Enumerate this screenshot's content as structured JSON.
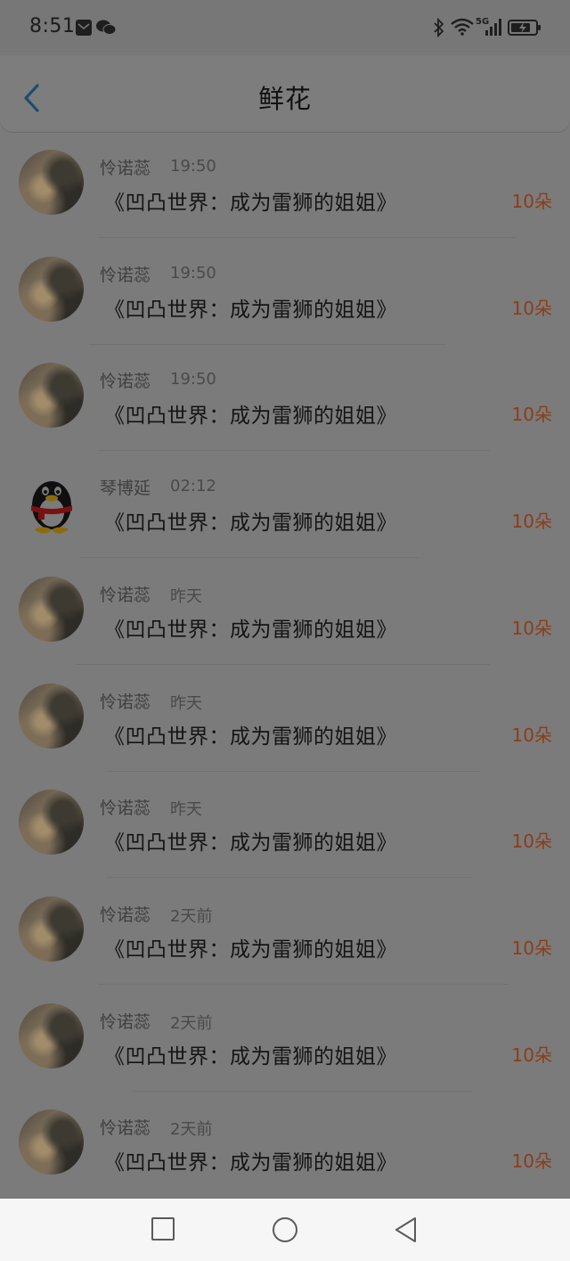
{
  "status_bar": {
    "time": "8:51",
    "network_label": "5G",
    "icons": [
      "mail-icon",
      "wechat-icon",
      "bluetooth-icon",
      "wifi-icon",
      "signal-icon",
      "battery-charging-icon"
    ]
  },
  "header": {
    "back_icon": "chevron-left-icon",
    "title": "鲜花"
  },
  "items": [
    {
      "name": "怜诺蕊",
      "time": "19:50",
      "book": "《凹凸世界：成为雷狮的姐姐》",
      "count": "10朵",
      "avatar": "photo"
    },
    {
      "name": "怜诺蕊",
      "time": "19:50",
      "book": "《凹凸世界：成为雷狮的姐姐》",
      "count": "10朵",
      "avatar": "photo"
    },
    {
      "name": "怜诺蕊",
      "time": "19:50",
      "book": "《凹凸世界：成为雷狮的姐姐》",
      "count": "10朵",
      "avatar": "photo"
    },
    {
      "name": "琴博延",
      "time": "02:12",
      "book": "《凹凸世界：成为雷狮的姐姐》",
      "count": "10朵",
      "avatar": "qq-penguin"
    },
    {
      "name": "怜诺蕊",
      "time": "昨天",
      "book": "《凹凸世界：成为雷狮的姐姐》",
      "count": "10朵",
      "avatar": "photo"
    },
    {
      "name": "怜诺蕊",
      "time": "昨天",
      "book": "《凹凸世界：成为雷狮的姐姐》",
      "count": "10朵",
      "avatar": "photo"
    },
    {
      "name": "怜诺蕊",
      "time": "昨天",
      "book": "《凹凸世界：成为雷狮的姐姐》",
      "count": "10朵",
      "avatar": "photo"
    },
    {
      "name": "怜诺蕊",
      "time": "2天前",
      "book": "《凹凸世界：成为雷狮的姐姐》",
      "count": "10朵",
      "avatar": "photo"
    },
    {
      "name": "怜诺蕊",
      "time": "2天前",
      "book": "《凹凸世界：成为雷狮的姐姐》",
      "count": "10朵",
      "avatar": "photo"
    },
    {
      "name": "怜诺蕊",
      "time": "2天前",
      "book": "《凹凸世界：成为雷狮的姐姐》",
      "count": "10朵",
      "avatar": "photo"
    }
  ],
  "nav_bar": {
    "icons": [
      "square-recents-icon",
      "circle-home-icon",
      "triangle-back-icon"
    ]
  },
  "colors": {
    "accent_count": "#8d3d17",
    "back_chevron": "#1f4e6e",
    "overlay_background": "#7b7b7b"
  }
}
